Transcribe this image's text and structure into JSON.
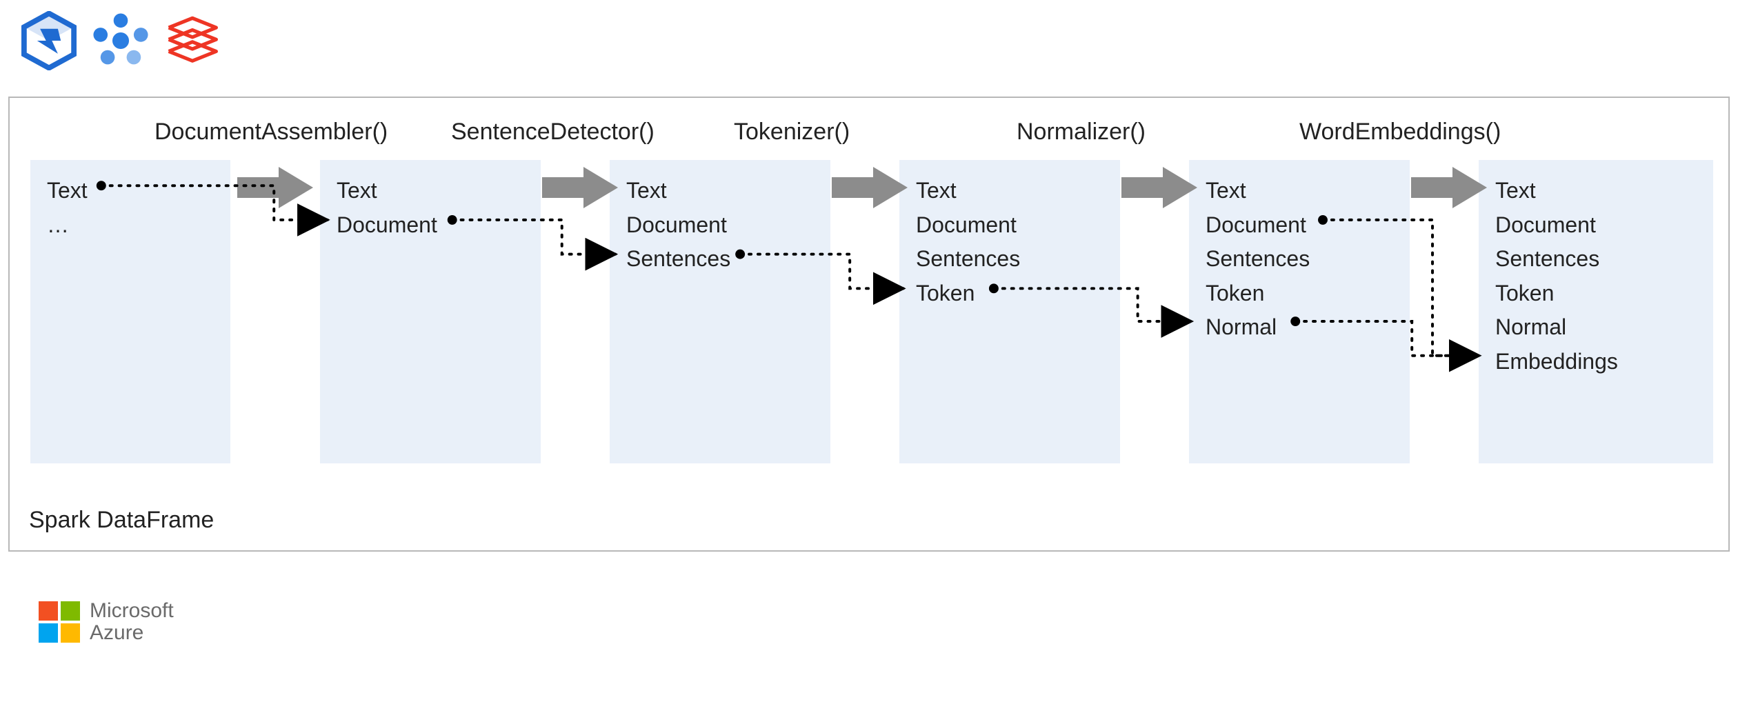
{
  "stages": {
    "s1": "DocumentAssembler()",
    "s2": "SentenceDetector()",
    "s3": "Tokenizer()",
    "s4": "Normalizer()",
    "s5": "WordEmbeddings()"
  },
  "cols": {
    "c0": {
      "i0": "Text",
      "i1": "…"
    },
    "c1": {
      "i0": "Text",
      "i1": "Document"
    },
    "c2": {
      "i0": "Text",
      "i1": "Document",
      "i2": "Sentences"
    },
    "c3": {
      "i0": "Text",
      "i1": "Document",
      "i2": "Sentences",
      "i3": "Token"
    },
    "c4": {
      "i0": "Text",
      "i1": "Document",
      "i2": "Sentences",
      "i3": "Token",
      "i4": "Normal"
    },
    "c5": {
      "i0": "Text",
      "i1": "Document",
      "i2": "Sentences",
      "i3": "Token",
      "i4": "Normal",
      "i5": "Embeddings"
    }
  },
  "frame_label": "Spark DataFrame",
  "footer": {
    "brand1": "Microsoft",
    "brand2": "Azure"
  },
  "colors": {
    "panel": "#e9f0f9",
    "arrow": "#8c8c8c",
    "synapse": "#1f6ad1",
    "ml": "#2a7de1",
    "db_red": "#ee3524"
  }
}
